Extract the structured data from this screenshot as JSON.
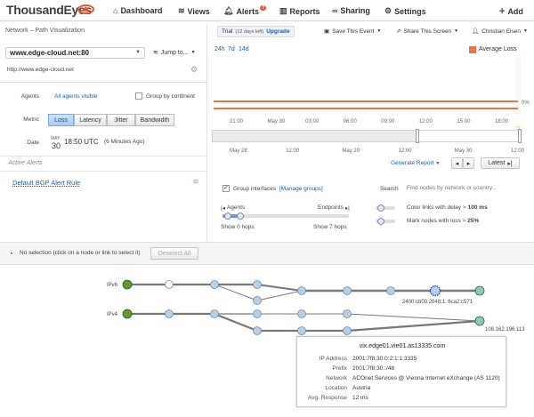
{
  "nav": {
    "logo": "ThousandEyes",
    "items": [
      {
        "label": "Dashboard",
        "icon": "home-icon"
      },
      {
        "label": "Views",
        "icon": "layers-icon"
      },
      {
        "label": "Alerts",
        "icon": "bell-icon",
        "badge": "7"
      },
      {
        "label": "Reports",
        "icon": "bar-chart-icon"
      },
      {
        "label": "Sharing",
        "icon": "link-icon"
      },
      {
        "label": "Settings",
        "icon": "gear-icon"
      }
    ],
    "add_label": "Add"
  },
  "page": {
    "title": "Network – Path Visualization",
    "test_select": "www.edge-cloud.net:80",
    "jump_to": "Jump to...",
    "url": "http://www.edge-cloud.net"
  },
  "topbar": {
    "trial_text": "Trial",
    "trial_days": "(12 days left)",
    "upgrade": "Upgrade",
    "save_event": "Save This Event",
    "share_screen": "Share This Screen",
    "user": "Christian Elsen"
  },
  "controls": {
    "agents_label": "Agents",
    "agents_value": "All agents visible",
    "group_by_continent": "Group by continent",
    "metric_label": "Metric",
    "metrics": [
      "Loss",
      "Latency",
      "Jitter",
      "Bandwidth"
    ],
    "active_metric": "Loss",
    "date_label": "Date",
    "date_month": "MAY",
    "date_day": "30",
    "date_time": "18:50 UTC",
    "date_ago": "(6 Minutes Ago)"
  },
  "alerts": {
    "heading": "Active Alerts",
    "items": [
      "Default BGP Alert Rule"
    ]
  },
  "timeline": {
    "ranges": [
      "24h",
      "7d",
      "14d"
    ],
    "legend": "Average Loss",
    "legend_color": "#e8764a",
    "y_top": "0%",
    "x_ticks": [
      "21:00",
      "May 30",
      "03:00",
      "06:00",
      "09:00",
      "12:00",
      "15:00",
      "18:00"
    ],
    "overview_ticks": [
      "May 28",
      "12:00",
      "May 29",
      "12:00",
      "May 30",
      "12:00"
    ],
    "generate_report": "Generate Report",
    "latest": "Latest"
  },
  "chart_data": {
    "type": "line",
    "title": "",
    "series": [
      {
        "name": "Average Loss",
        "values": [
          0,
          0,
          0,
          0,
          0,
          0,
          0,
          0
        ]
      }
    ],
    "categories": [
      "21:00",
      "May 30",
      "03:00",
      "06:00",
      "09:00",
      "12:00",
      "15:00",
      "18:00"
    ],
    "ylabel": "",
    "ylim": [
      0,
      100
    ]
  },
  "path_options": {
    "group_interfaces": "Group interfaces",
    "manage_groups": "[Manage groups]",
    "search_label": "Search",
    "search_placeholder": "Find nodes by network or country...",
    "agents_end": "Agents",
    "endpoints_end": "Endpoints",
    "show_agents": "Show 0 hops",
    "show_endpoints": "Show 7 hops",
    "color_links": "Color links with delay >",
    "color_links_value": "100 ms",
    "mark_nodes": "Mark nodes with loss >",
    "mark_nodes_value": "25%"
  },
  "selection": {
    "text": "No selection (click on a node or link to select it)",
    "deselect": "Deselect All"
  },
  "graph": {
    "ipv6_label": "IPv6",
    "ipv4_label": "IPv4",
    "ipv6_dest": "2400:cb00:2048:1::6ca2:c571",
    "ipv4_dest": "108.162.196.113"
  },
  "tooltip": {
    "title": "vix.edge01.vie01.as13335.com",
    "rows": [
      {
        "k": "IP Address",
        "v": "2001:7f8:30:0:2:1:1:3335"
      },
      {
        "k": "Prefix",
        "v": "2001:7f8:30::/48"
      },
      {
        "k": "Network",
        "v": "ACOnet Services @ Vienna Internet eXchange (AS 1120)"
      },
      {
        "k": "Location",
        "v": "Austria"
      },
      {
        "k": "Avg. Response",
        "v": "12 ms"
      }
    ]
  }
}
